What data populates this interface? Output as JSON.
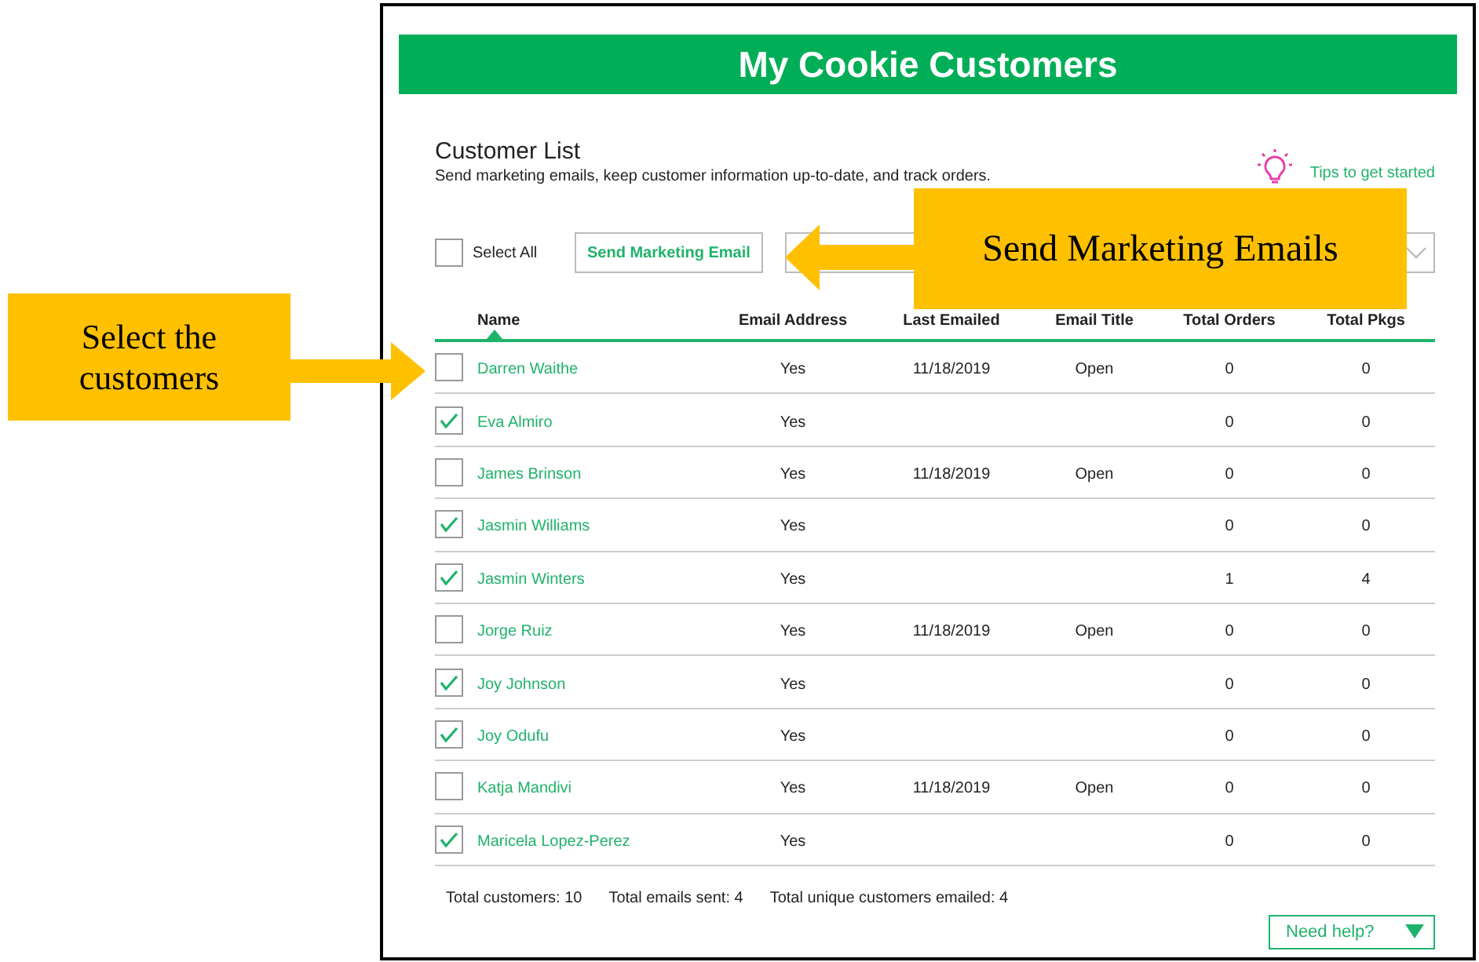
{
  "banner": {
    "title": "My Cookie Customers"
  },
  "section": {
    "title": "Customer List",
    "subtitle": "Send marketing emails, keep customer information up-to-date, and track orders.",
    "tips_link": "Tips to get started"
  },
  "toolbar": {
    "select_all": {
      "label": "Select All",
      "checked": false
    },
    "send_button": "Send Marketing Email"
  },
  "table": {
    "columns": [
      "Name",
      "Email Address",
      "Last Emailed",
      "Email Title",
      "Total Orders",
      "Total Pkgs"
    ],
    "rows": [
      {
        "name": "Darren Waithe",
        "email": "Yes",
        "last_emailed": "11/18/2019",
        "email_title": "Open",
        "total_orders": "0",
        "total_pkgs": "0",
        "selected": false
      },
      {
        "name": "Eva Almiro",
        "email": "Yes",
        "total_orders": "0",
        "total_pkgs": "0",
        "selected": true
      },
      {
        "name": "James Brinson",
        "email": "Yes",
        "last_emailed": "11/18/2019",
        "email_title": "Open",
        "total_orders": "0",
        "total_pkgs": "0",
        "selected": false
      },
      {
        "name": "Jasmin Williams",
        "email": "Yes",
        "total_orders": "0",
        "total_pkgs": "0",
        "selected": true
      },
      {
        "name": "Jasmin Winters",
        "email": "Yes",
        "total_orders": "1",
        "total_pkgs": "4",
        "selected": true
      },
      {
        "name": "Jorge Ruiz",
        "email": "Yes",
        "last_emailed": "11/18/2019",
        "email_title": "Open",
        "total_orders": "0",
        "total_pkgs": "0",
        "selected": false
      },
      {
        "name": "Joy Johnson",
        "email": "Yes",
        "total_orders": "0",
        "total_pkgs": "0",
        "selected": true
      },
      {
        "name": "Joy Odufu",
        "email": "Yes",
        "total_orders": "0",
        "total_pkgs": "0",
        "selected": true
      },
      {
        "name": "Katja Mandivi",
        "email": "Yes",
        "last_emailed": "11/18/2019",
        "email_title": "Open",
        "total_orders": "0",
        "total_pkgs": "0",
        "selected": false
      },
      {
        "name": "Maricela Lopez-Perez",
        "email": "Yes",
        "total_orders": "0",
        "total_pkgs": "0",
        "selected": true
      }
    ]
  },
  "footer": {
    "stats": [
      "Total customers: 10",
      "Total emails sent: 4",
      "Total unique customers emailed: 4"
    ],
    "help_button": "Need help?"
  },
  "annotations": [
    {
      "text": "Select the customers"
    },
    {
      "text": "Send Marketing Emails"
    }
  ]
}
